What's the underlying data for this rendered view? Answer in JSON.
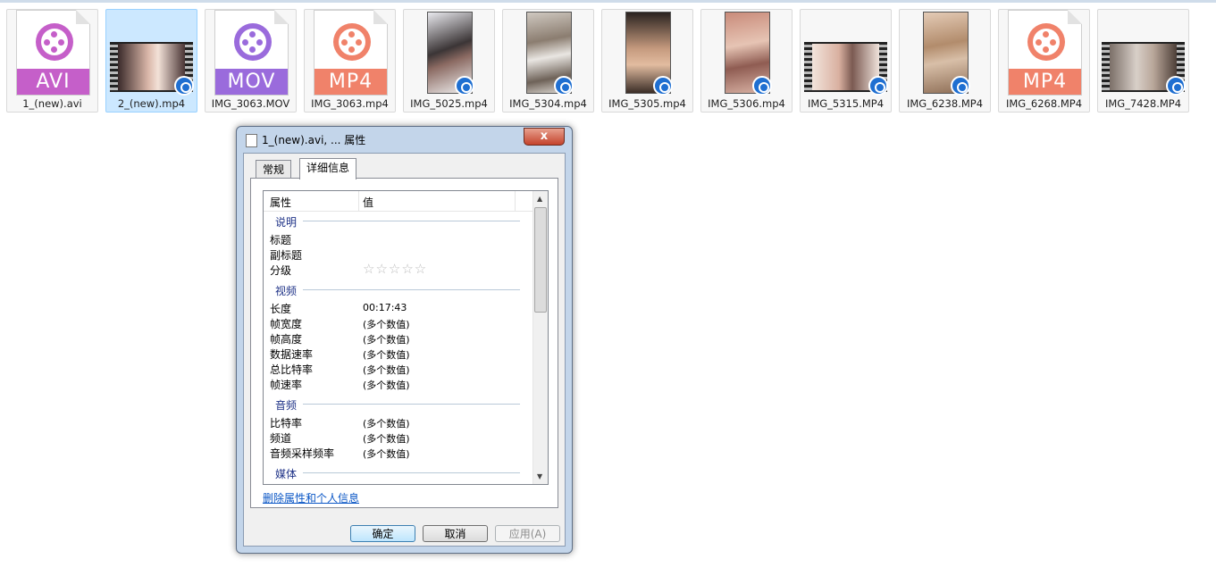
{
  "files": [
    {
      "name": "1_(new).avi",
      "kind": "doc",
      "badge": "AVI",
      "color": "#c55fc9"
    },
    {
      "name": "2_(new).mp4",
      "kind": "film"
    },
    {
      "name": "IMG_3063.MOV",
      "kind": "doc",
      "badge": "MOV",
      "color": "#9a6bdc"
    },
    {
      "name": "IMG_3063.mp4",
      "kind": "doc",
      "badge": "MP4",
      "color": "#f0826a"
    },
    {
      "name": "IMG_5025.mp4",
      "kind": "portrait"
    },
    {
      "name": "IMG_5304.mp4",
      "kind": "portrait"
    },
    {
      "name": "IMG_5305.mp4",
      "kind": "portrait"
    },
    {
      "name": "IMG_5306.mp4",
      "kind": "portrait"
    },
    {
      "name": "IMG_5315.MP4",
      "kind": "film"
    },
    {
      "name": "IMG_6238.MP4",
      "kind": "portrait"
    },
    {
      "name": "IMG_6268.MP4",
      "kind": "doc",
      "badge": "MP4",
      "color": "#f0826a"
    },
    {
      "name": "IMG_7428.MP4",
      "kind": "film"
    }
  ],
  "dialog": {
    "title": "1_(new).avi, ... 属性",
    "close": "x",
    "tabs": [
      "常规",
      "详细信息"
    ],
    "columns": {
      "property": "属性",
      "value": "值"
    },
    "groups": {
      "description": "说明",
      "video": "视频",
      "audio": "音频",
      "media": "媒体"
    },
    "rows": {
      "title": "标题",
      "subtitle": "副标题",
      "rating": "分级",
      "length": "长度",
      "length_value": "00:17:43",
      "frame_width": "帧宽度",
      "frame_height": "帧高度",
      "data_rate": "数据速率",
      "total_bitrate": "总比特率",
      "frame_rate": "帧速率",
      "bitrate": "比特率",
      "channels": "频道",
      "sample_rate": "音频采样频率",
      "multiple": "(多个数值)"
    },
    "rating_stars": "☆☆☆☆☆",
    "remove_link": "删除属性和个人信息",
    "buttons": {
      "ok": "确定",
      "cancel": "取消",
      "apply": "应用(A)"
    }
  },
  "colors": {
    "selected": "#cce8ff",
    "accent": "#1f6fd1"
  }
}
